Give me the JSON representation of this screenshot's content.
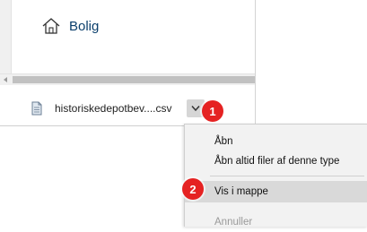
{
  "page": {
    "nav_item_label": "Bolig"
  },
  "download": {
    "file_name": "historiskedepotbev....csv"
  },
  "context_menu": {
    "items": [
      {
        "label": "Åbn"
      },
      {
        "label": "Åbn altid filer af denne type"
      },
      {
        "label": "Vis i mappe"
      },
      {
        "label": "Annuller"
      }
    ]
  },
  "annotations": {
    "badge_1": "1",
    "badge_2": "2",
    "badge_color": "#e52222"
  },
  "colors": {
    "link_text": "#0b3f6c",
    "menu_background": "#f2f2f2",
    "menu_highlight": "#d9d9d9"
  },
  "icons": {
    "nav_item": "house-icon",
    "file": "csv-file-icon",
    "menu_toggle": "chevron-down-icon"
  }
}
